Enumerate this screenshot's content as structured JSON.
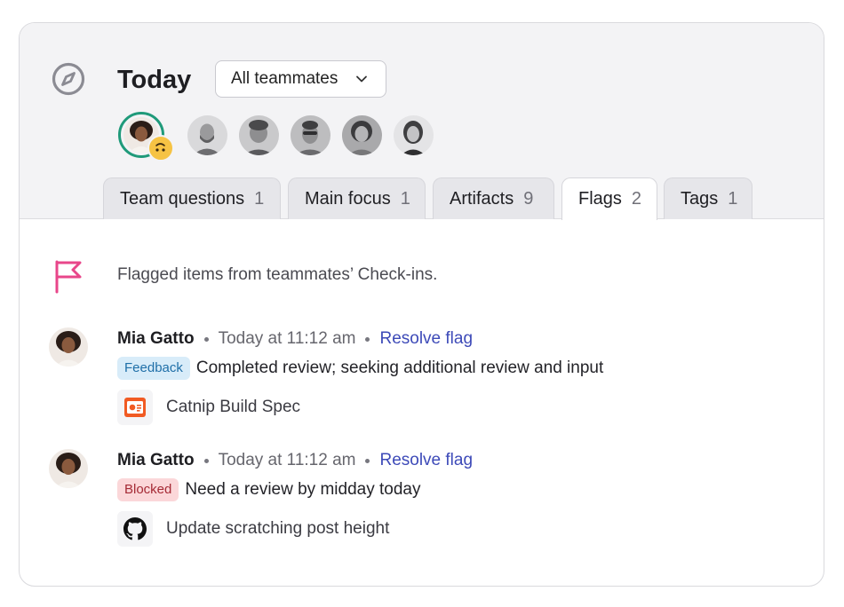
{
  "header": {
    "title": "Today",
    "filter": {
      "selected": "All teammates"
    }
  },
  "avatars": [
    {
      "name": "current-user",
      "has_status_emoji": true
    },
    {
      "name": "teammate-2"
    },
    {
      "name": "teammate-3"
    },
    {
      "name": "teammate-4"
    },
    {
      "name": "teammate-5"
    },
    {
      "name": "teammate-6"
    }
  ],
  "tabs": [
    {
      "label": "Team questions",
      "count": "1",
      "active": false
    },
    {
      "label": "Main focus",
      "count": "1",
      "active": false
    },
    {
      "label": "Artifacts",
      "count": "9",
      "active": false
    },
    {
      "label": "Flags",
      "count": "2",
      "active": true
    },
    {
      "label": "Tags",
      "count": "1",
      "active": false
    }
  ],
  "flags_panel": {
    "intro": "Flagged items from teammates’ Check-ins.",
    "entries": [
      {
        "author": "Mia Gatto",
        "time": "Today at 11:12 am",
        "action": "Resolve flag",
        "badge": "Feedback",
        "badge_color": "#d8ecf9",
        "message": "Completed review; seeking additional review and input",
        "attachment": {
          "icon": "slides-icon",
          "label": "Catnip Build Spec"
        }
      },
      {
        "author": "Mia Gatto",
        "time": "Today at 11:12 am",
        "action": "Resolve flag",
        "badge": "Blocked",
        "badge_color": "#fbd7d9",
        "message": "Need a review by midday today",
        "attachment": {
          "icon": "github-icon",
          "label": "Update scratching post height"
        }
      }
    ]
  },
  "colors": {
    "accent_link": "#3d4ab8",
    "flag_pink": "#e8468a",
    "active_ring": "#1f9a7a"
  }
}
